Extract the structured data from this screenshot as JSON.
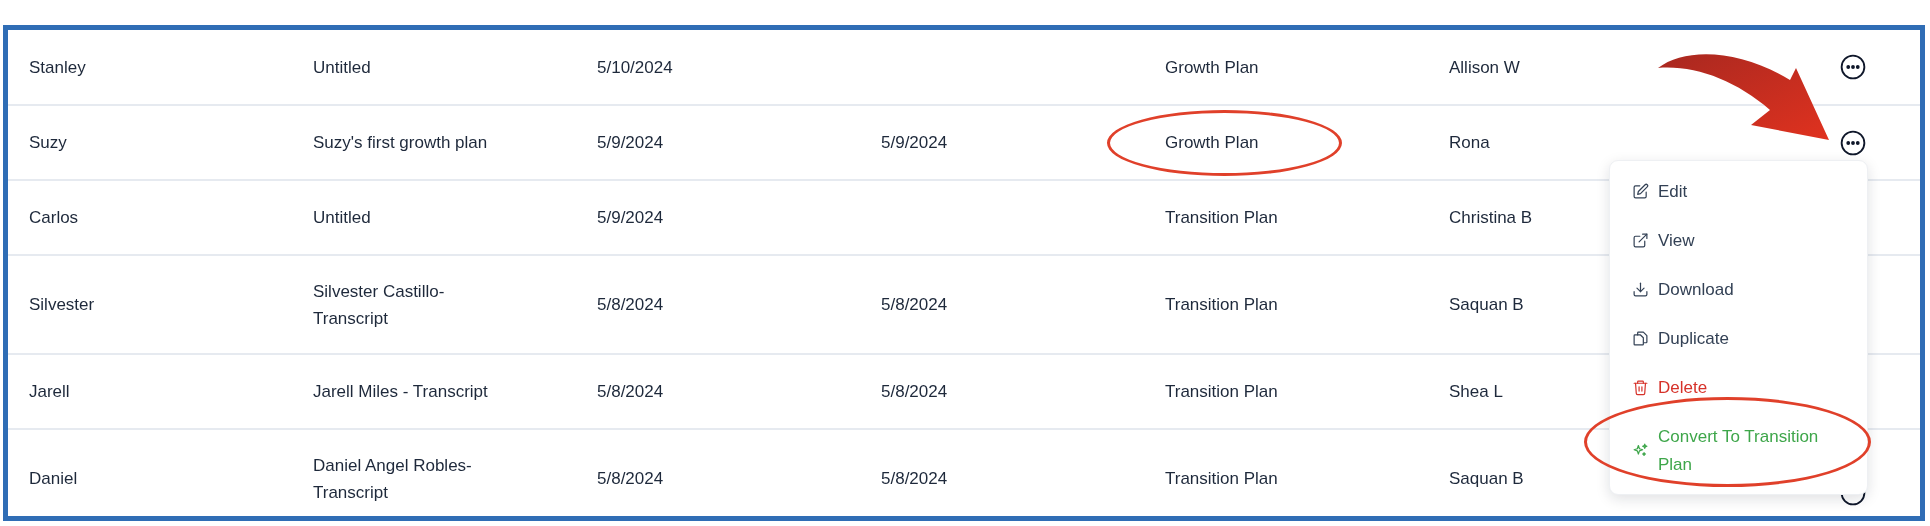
{
  "table": {
    "rows": [
      {
        "cells": [
          {
            "text": "Stanley",
            "circled": false
          },
          {
            "text": "Untitled",
            "circled": false
          },
          {
            "text": "5/10/2024",
            "circled": false
          },
          {
            "circled": false
          },
          {
            "text": "Growth Plan",
            "circled": false
          },
          {
            "text": "Allison W",
            "circled": false
          }
        ],
        "action_button": true,
        "menu_open": false,
        "arrow": false
      },
      {
        "cells": [
          {
            "text": "Suzy",
            "circled": false
          },
          {
            "text": "Suzy's first growth plan",
            "circled": false
          },
          {
            "text": "5/9/2024",
            "circled": false
          },
          {
            "text": "5/9/2024",
            "circled": false
          },
          {
            "text": "Growth Plan",
            "circled": true
          },
          {
            "text": "Rona",
            "circled": false
          }
        ],
        "action_button": true,
        "menu_open": true,
        "arrow": true
      },
      {
        "cells": [
          {
            "text": "Carlos",
            "circled": false
          },
          {
            "text": "Untitled",
            "circled": false
          },
          {
            "text": "5/9/2024",
            "circled": false
          },
          {
            "circled": false
          },
          {
            "text": "Transition Plan",
            "circled": false
          },
          {
            "text": "Christina B",
            "circled": false
          }
        ],
        "action_button": false,
        "menu_open": false,
        "arrow": false
      },
      {
        "cells": [
          {
            "text": "Silvester",
            "circled": false
          },
          {
            "text": "Silvester Castillo-Transcript",
            "circled": false
          },
          {
            "text": "5/8/2024",
            "circled": false
          },
          {
            "text": "5/8/2024",
            "circled": false
          },
          {
            "text": "Transition Plan",
            "circled": false
          },
          {
            "text": "Saquan B",
            "circled": false
          }
        ],
        "action_button": false,
        "menu_open": false,
        "arrow": false
      },
      {
        "cells": [
          {
            "text": "Jarell",
            "circled": false
          },
          {
            "text": "Jarell Miles - Transcript",
            "circled": false
          },
          {
            "text": "5/8/2024",
            "circled": false
          },
          {
            "text": "5/8/2024",
            "circled": false
          },
          {
            "text": "Transition Plan",
            "circled": false
          },
          {
            "text": "Shea L",
            "circled": false
          }
        ],
        "action_button": false,
        "menu_open": false,
        "arrow": false
      },
      {
        "cells": [
          {
            "text": "Daniel",
            "circled": false
          },
          {
            "text": "Daniel Angel Robles-Transcript",
            "circled": false
          },
          {
            "text": "5/8/2024",
            "circled": false
          },
          {
            "text": "5/8/2024",
            "circled": false
          },
          {
            "text": "Transition Plan",
            "circled": false
          },
          {
            "text": "Saquan B",
            "circled": false
          }
        ],
        "action_button": true,
        "menu_open": false,
        "arrow": false
      }
    ]
  },
  "menu": {
    "items": [
      {
        "kind": "edit",
        "label": "Edit",
        "circled": false
      },
      {
        "kind": "view",
        "label": "View",
        "circled": false
      },
      {
        "kind": "download",
        "label": "Download",
        "circled": false
      },
      {
        "kind": "duplicate",
        "label": "Duplicate",
        "circled": false
      },
      {
        "kind": "delete",
        "label": "Delete",
        "circled": false
      },
      {
        "kind": "convert",
        "label": "Convert To Transition Plan",
        "circled": true
      }
    ]
  }
}
